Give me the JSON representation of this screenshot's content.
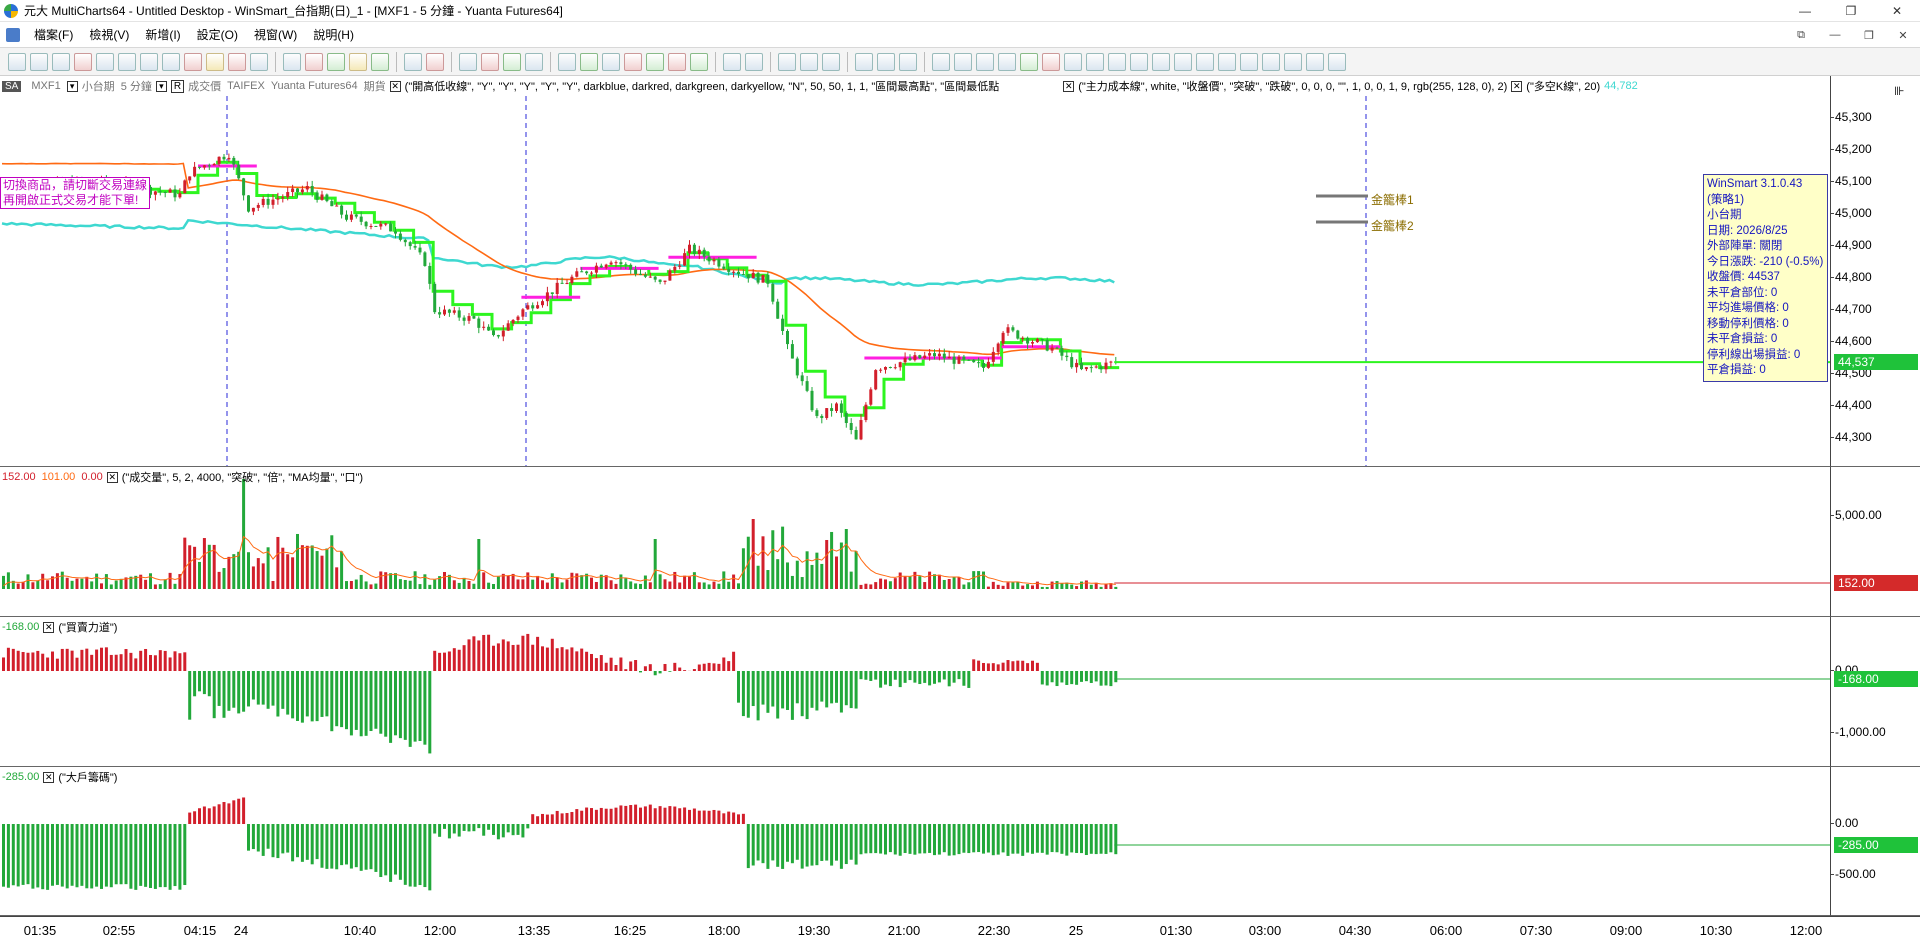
{
  "window": {
    "title": "元大 MultiCharts64 - Untitled Desktop - WinSmart_台指期(日)_1 - [MXF1 - 5 分鐘 - Yuanta Futures64]",
    "min_glyph": "—",
    "max_glyph": "❐",
    "close_glyph": "✕"
  },
  "menu": {
    "items": [
      "檔案(F)",
      "檢視(V)",
      "新增(I)",
      "設定(O)",
      "視窗(W)",
      "說明(H)"
    ],
    "right_glyphs": [
      "⧉",
      "—",
      "❐",
      "✕"
    ]
  },
  "legend": {
    "symbol_badge": "SA",
    "symbol": "MXF1",
    "resolution": "小台期",
    "interval": "5 分鐘",
    "r_badge": "R",
    "field": "成交價",
    "exchange": "TAIFEX",
    "datasource": "Yuanta Futures64",
    "category": "期貨",
    "close_glyph": "✕",
    "study1": "(\"開高低收線\", \"Y\", \"Y\", \"Y\", \"Y\", \"Y\", darkblue, darkred, darkgreen, darkyellow, \"N\", 50, 50, 1, 1, \"區間最高點\", \"區間最低點",
    "study2": "(\"主力成本線\", white, \"收盤價\", \"突破\", \"跌破\", 0, 0, 0, \"\", 1, 0, 0, 1, 9, rgb(255, 128, 0), 2)",
    "study3": "(\"多空K線\", 20)",
    "study3_value": "44,782"
  },
  "warning": {
    "lines": [
      "切換商品，請切斷交易連線",
      "再開啟正式交易才能下單!"
    ]
  },
  "info_box": {
    "lines": [
      "WinSmart 3.1.0.43",
      "(策略1)",
      "小台期",
      "日期: 2026/8/25",
      "外部陣單: 關閉",
      "今日漲跌: -210 (-0.5%)",
      "收盤價: 44537",
      "未平倉部位: 0",
      "平均進場價格: 0",
      "移動停利價格: 0",
      "未平倉損益: 0",
      "停利線出場損益: 0",
      "平倉損益: 0"
    ]
  },
  "gold_labels": [
    "金籠棒1",
    "金籠棒2"
  ],
  "price_axis": {
    "ticks": [
      "45,300",
      "45,200",
      "45,100",
      "45,000",
      "44,900",
      "44,800",
      "44,700",
      "44,600",
      "44,500",
      "44,400",
      "44,300"
    ],
    "last_price": "44,537"
  },
  "volume_pane": {
    "legend_values": [
      "152.00",
      "101.00",
      "0.00"
    ],
    "legend_text": "(\"成交量\", 5, 2, 4000, \"突破\", \"倍\", \"MA均量\", \"口\")",
    "close_glyph": "✕",
    "ticks": [
      "5,000.00"
    ],
    "last_value": "152.00"
  },
  "force_pane": {
    "legend_value": "-168.00",
    "legend_text": "(\"買賣力道\")",
    "close_glyph": "✕",
    "ticks": [
      "0.00",
      "-1,000.00"
    ],
    "last_value": "-168.00"
  },
  "chips_pane": {
    "legend_value": "-285.00",
    "legend_text": "(\"大戶籌碼\")",
    "close_glyph": "✕",
    "ticks": [
      "0.00",
      "-500.00"
    ],
    "last_value": "-285.00"
  },
  "time_axis": {
    "labels": [
      "01:35",
      "02:55",
      "04:15",
      "24",
      "10:40",
      "12:00",
      "13:35",
      "16:25",
      "18:00",
      "19:30",
      "21:00",
      "22:30",
      "25",
      "01:30",
      "03:00",
      "04:30",
      "06:00",
      "07:30",
      "09:00",
      "10:30",
      "12:00"
    ]
  },
  "colors": {
    "up": "#d21f2b",
    "down": "#22a83a",
    "green_line": "#2df51f",
    "magenta": "#ff1fe0",
    "orange": "#ff6a13",
    "cyan": "#3ed8d0",
    "session": "#2a2ad8",
    "badge_green": "#1fc23a",
    "badge_red": "#d42a2a"
  }
}
